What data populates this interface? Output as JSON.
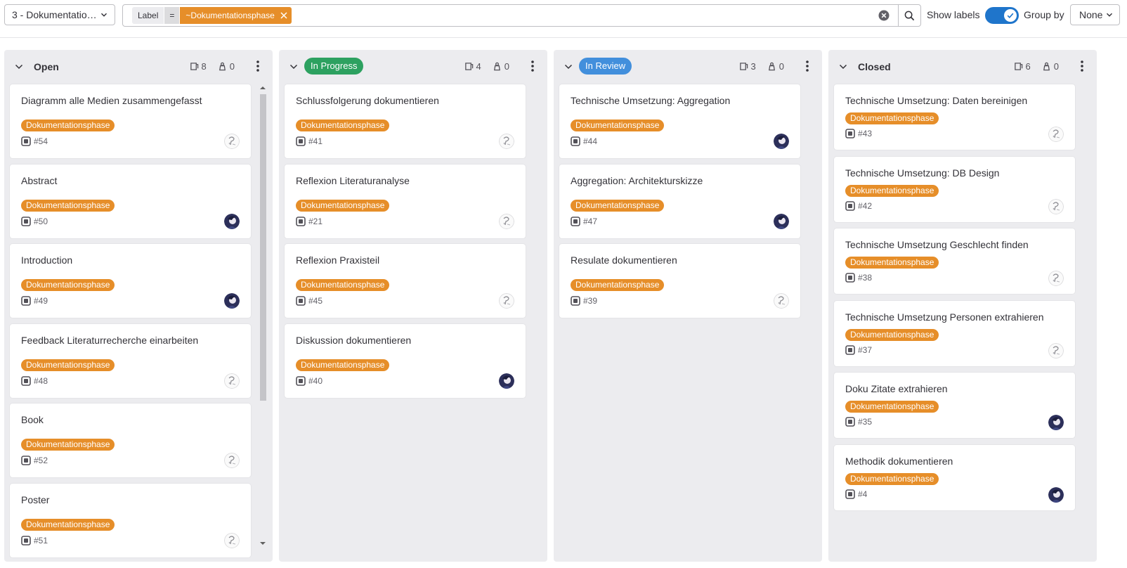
{
  "header": {
    "board_select": "3 - Dokumentationsphase",
    "filter": {
      "token_label": "Label",
      "token_operator": "=",
      "token_value": "~Dokumentationsphase"
    },
    "show_labels": "Show labels",
    "show_labels_on": true,
    "group_by_label": "Group by",
    "group_by_value": "None"
  },
  "colors": {
    "label_orange": "#e68e29",
    "in_progress": "#2da160",
    "in_review": "#428fdc",
    "toggle_blue": "#1f75cb"
  },
  "columns": [
    {
      "title": "Open",
      "pill": false,
      "issue_count": "8",
      "weight": "0",
      "cards": [
        {
          "title": "Diagramm alle Medien zusammengefasst",
          "label": "Dokumentationsphase",
          "ref": "#54",
          "avatar": "sketch-avatar"
        },
        {
          "title": "Abstract",
          "label": "Dokumentationsphase",
          "ref": "#50",
          "avatar": "photo-avatar"
        },
        {
          "title": "Introduction",
          "label": "Dokumentationsphase",
          "ref": "#49",
          "avatar": "photo-avatar"
        },
        {
          "title": "Feedback Literaturrecherche einarbeiten",
          "label": "Dokumentationsphase",
          "ref": "#48",
          "avatar": "sketch-avatar"
        },
        {
          "title": "Book",
          "label": "Dokumentationsphase",
          "ref": "#52",
          "avatar": "sketch-avatar"
        },
        {
          "title": "Poster",
          "label": "Dokumentationsphase",
          "ref": "#51",
          "avatar": "sketch-avatar"
        }
      ]
    },
    {
      "title": "In Progress",
      "pill": true,
      "pill_color": "#2da160",
      "issue_count": "4",
      "weight": "0",
      "cards": [
        {
          "title": "Schlussfolgerung dokumentieren",
          "label": "Dokumentationsphase",
          "ref": "#41",
          "avatar": "sketch-avatar"
        },
        {
          "title": "Reflexion Literaturanalyse",
          "label": "Dokumentationsphase",
          "ref": "#21",
          "avatar": "sketch-avatar"
        },
        {
          "title": "Reflexion Praxisteil",
          "label": "Dokumentationsphase",
          "ref": "#45",
          "avatar": "sketch-avatar"
        },
        {
          "title": "Diskussion dokumentieren",
          "label": "Dokumentationsphase",
          "ref": "#40",
          "avatar": "photo-avatar"
        }
      ]
    },
    {
      "title": "In Review",
      "pill": true,
      "pill_color": "#428fdc",
      "issue_count": "3",
      "weight": "0",
      "cards": [
        {
          "title": "Technische Umsetzung: Aggregation",
          "label": "Dokumentationsphase",
          "ref": "#44",
          "avatar": "photo-avatar"
        },
        {
          "title": "Aggregation: Architekturskizze",
          "label": "Dokumentationsphase",
          "ref": "#47",
          "avatar": "photo-avatar"
        },
        {
          "title": "Resulate dokumentieren",
          "label": "Dokumentationsphase",
          "ref": "#39",
          "avatar": "sketch-avatar"
        }
      ]
    },
    {
      "title": "Closed",
      "pill": false,
      "issue_count": "6",
      "weight": "0",
      "cards": [
        {
          "title": "Technische Umsetzung: Daten bereinigen",
          "label": "Dokumentationsphase",
          "ref": "#43",
          "avatar": "sketch-avatar"
        },
        {
          "title": "Technische Umsetzung: DB Design",
          "label": "Dokumentationsphase",
          "ref": "#42",
          "avatar": "sketch-avatar"
        },
        {
          "title": "Technische Umsetzung Geschlecht finden",
          "label": "Dokumentationsphase",
          "ref": "#38",
          "avatar": "sketch-avatar"
        },
        {
          "title": "Technische Umsetzung Personen extrahieren",
          "label": "Dokumentationsphase",
          "ref": "#37",
          "avatar": "sketch-avatar"
        },
        {
          "title": "Doku Zitate extrahieren",
          "label": "Dokumentationsphase",
          "ref": "#35",
          "avatar": "photo-avatar"
        },
        {
          "title": "Methodik dokumentieren",
          "label": "Dokumentationsphase",
          "ref": "#4",
          "avatar": "photo-avatar"
        }
      ]
    }
  ]
}
